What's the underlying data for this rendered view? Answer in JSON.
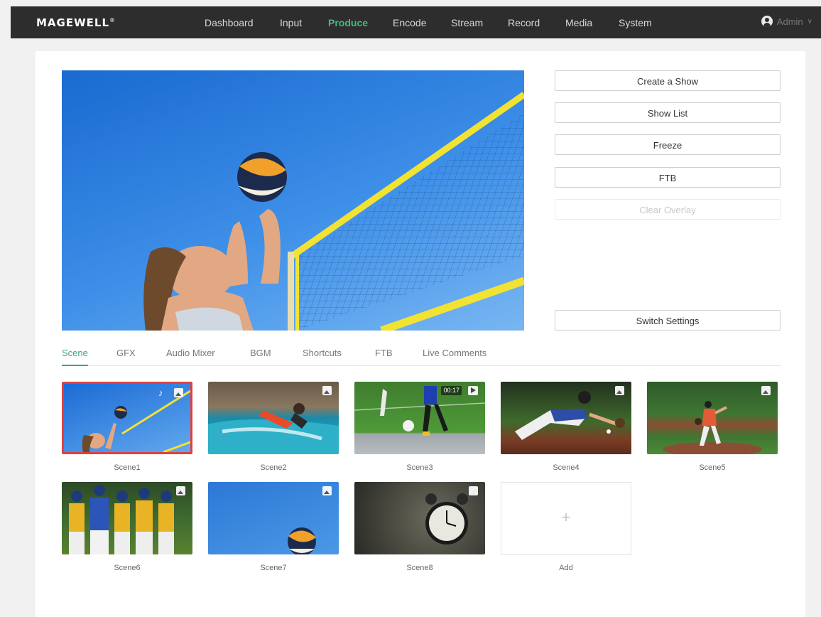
{
  "app": {
    "brand": "MAGEWELL",
    "brand_mark": "®"
  },
  "nav": {
    "items": [
      {
        "label": "Dashboard"
      },
      {
        "label": "Input"
      },
      {
        "label": "Produce"
      },
      {
        "label": "Encode"
      },
      {
        "label": "Stream"
      },
      {
        "label": "Record"
      },
      {
        "label": "Media"
      },
      {
        "label": "System"
      }
    ],
    "active": "Produce"
  },
  "user": {
    "name": "Admin",
    "caret": "∨"
  },
  "controls": {
    "create_show": "Create a Show",
    "show_list": "Show List",
    "freeze": "Freeze",
    "ftb": "FTB",
    "clear_overlay": "Clear Overlay",
    "switch_settings": "Switch Settings"
  },
  "tabs": {
    "items": [
      {
        "label": "Scene"
      },
      {
        "label": "GFX"
      },
      {
        "label": "Audio Mixer"
      },
      {
        "label": "BGM"
      },
      {
        "label": "Shortcuts"
      },
      {
        "label": "FTB"
      },
      {
        "label": "Live Comments"
      }
    ],
    "active": "Scene"
  },
  "scenes": [
    {
      "label": "Scene1",
      "selected": true
    },
    {
      "label": "Scene2"
    },
    {
      "label": "Scene3",
      "duration": "00:17"
    },
    {
      "label": "Scene4"
    },
    {
      "label": "Scene5"
    },
    {
      "label": "Scene6"
    },
    {
      "label": "Scene7"
    },
    {
      "label": "Scene8"
    }
  ],
  "add_scene": {
    "label": "Add",
    "icon": "+"
  },
  "icons": {
    "music_note": "♪"
  },
  "colors": {
    "topbar_bg": "#2d2d2d",
    "nav_active": "#3fbf7f",
    "tab_active": "#3aa878",
    "selected_border": "#e04040"
  }
}
